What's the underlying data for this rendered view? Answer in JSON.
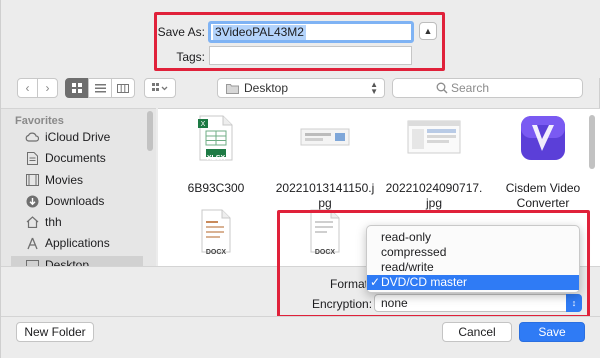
{
  "save": {
    "save_as_label": "Save As:",
    "filename": "3VideoPAL43M2",
    "tags_label": "Tags:",
    "tags_value": ""
  },
  "toolbar": {
    "location": "Desktop",
    "search_placeholder": "Search"
  },
  "sidebar": {
    "heading": "Favorites",
    "items": [
      {
        "label": "iCloud Drive",
        "icon": "cloud-icon"
      },
      {
        "label": "Documents",
        "icon": "document-icon"
      },
      {
        "label": "Movies",
        "icon": "film-icon"
      },
      {
        "label": "Downloads",
        "icon": "download-icon"
      },
      {
        "label": "thh",
        "icon": "home-icon"
      },
      {
        "label": "Applications",
        "icon": "applications-icon"
      },
      {
        "label": "Desktop",
        "icon": "desktop-icon"
      }
    ]
  },
  "files": [
    {
      "line1": "6B93C300",
      "line2": "",
      "thumb": "xlsx-icon",
      "badge": "XLSX"
    },
    {
      "line1": "20221013141150.j",
      "line2": "pg",
      "thumb": "image-thumb"
    },
    {
      "line1": "20221024090717.",
      "line2": "jpg",
      "thumb": "image-thumb"
    },
    {
      "line1": "Cisdem Video",
      "line2": "Converter",
      "thumb": "app-icon"
    },
    {
      "line1": "",
      "line2": "",
      "thumb": "docx-icon",
      "badge": "DOCX"
    },
    {
      "line1": "",
      "line2": "",
      "thumb": "docx-icon",
      "badge": "DOCX"
    }
  ],
  "options": {
    "format_label": "Format",
    "encryption_label": "Encryption:",
    "encryption_value": "none",
    "format_menu": [
      {
        "label": "read-only",
        "checked": false
      },
      {
        "label": "compressed",
        "checked": false
      },
      {
        "label": "read/write",
        "checked": false
      },
      {
        "label": "DVD/CD master",
        "checked": true
      }
    ]
  },
  "footer": {
    "new_folder_label": "New Folder",
    "cancel_label": "Cancel",
    "save_label": "Save"
  },
  "colors": {
    "accent": "#2f7bf5",
    "highlight_box": "#e0213a",
    "selection": "#b3d3fb"
  }
}
